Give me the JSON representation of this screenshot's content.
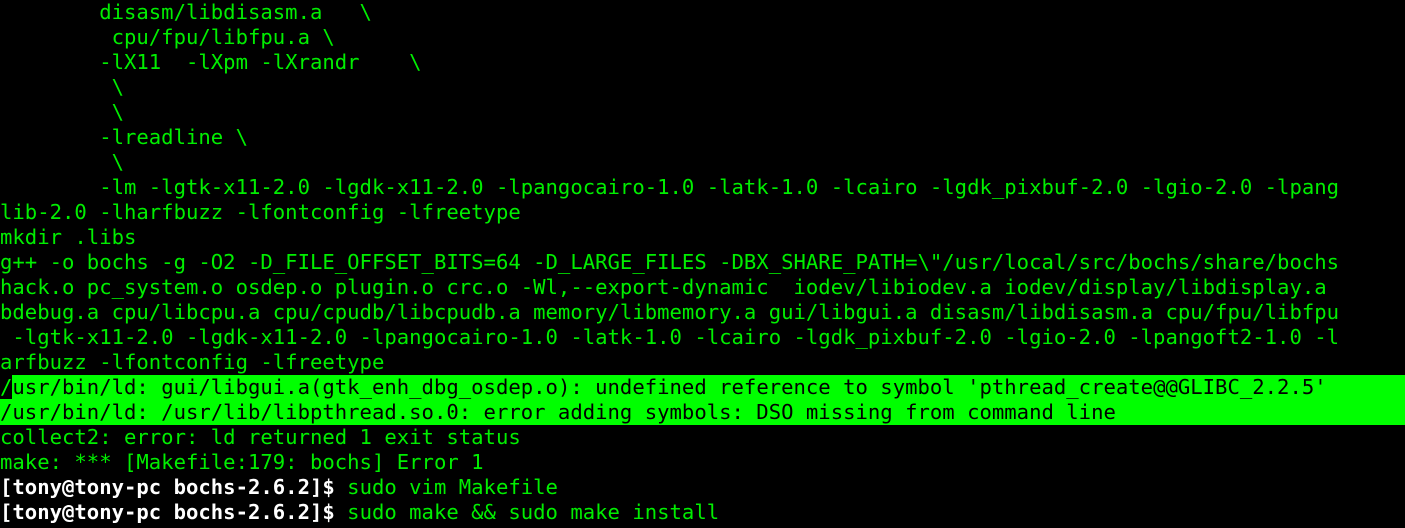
{
  "terminal": {
    "lines": [
      "        disasm/libdisasm.a   \\",
      "         cpu/fpu/libfpu.a \\",
      "        -lX11  -lXpm -lXrandr    \\",
      "         \\",
      "         \\",
      "        -lreadline \\",
      "         \\",
      "        -lm -lgtk-x11-2.0 -lgdk-x11-2.0 -lpangocairo-1.0 -latk-1.0 -lcairo -lgdk_pixbuf-2.0 -lgio-2.0 -lpang",
      "lib-2.0 -lharfbuzz -lfontconfig -lfreetype",
      "mkdir .libs",
      "g++ -o bochs -g -O2 -D_FILE_OFFSET_BITS=64 -D_LARGE_FILES -DBX_SHARE_PATH=\\\"/usr/local/src/bochs/share/bochs",
      "hack.o pc_system.o osdep.o plugin.o crc.o -Wl,--export-dynamic  iodev/libiodev.a iodev/display/libdisplay.a",
      "bdebug.a cpu/libcpu.a cpu/cpudb/libcpudb.a memory/libmemory.a gui/libgui.a disasm/libdisasm.a cpu/fpu/libfpu",
      " -lgtk-x11-2.0 -lgdk-x11-2.0 -lpangocairo-1.0 -latk-1.0 -lcairo -lgdk_pixbuf-2.0 -lgio-2.0 -lpangoft2-1.0 -l",
      "arfbuzz -lfontconfig -lfreetype"
    ],
    "error_lines": {
      "line1_first": "/",
      "line1_rest": "usr/bin/ld: gui/libgui.a(gtk_enh_dbg_osdep.o): undefined reference to symbol 'pthread_create@@GLIBC_2.2.5'",
      "line2": "/usr/bin/ld: /usr/lib/libpthread.so.0: error adding symbols: DSO missing from command line"
    },
    "after_error": [
      "collect2: error: ld returned 1 exit status",
      "make: *** [Makefile:179: bochs] Error 1"
    ],
    "prompts": [
      {
        "prompt": "[tony@tony-pc bochs-2.6.2]$",
        "command": " sudo vim Makefile"
      },
      {
        "prompt": "[tony@tony-pc bochs-2.6.2]$",
        "command": " sudo make && sudo make install"
      }
    ]
  },
  "colors": {
    "background": "#000000",
    "text": "#00ee00",
    "highlight_bg": "#00ff00",
    "highlight_fg": "#000000",
    "prompt": "#ffffff"
  }
}
